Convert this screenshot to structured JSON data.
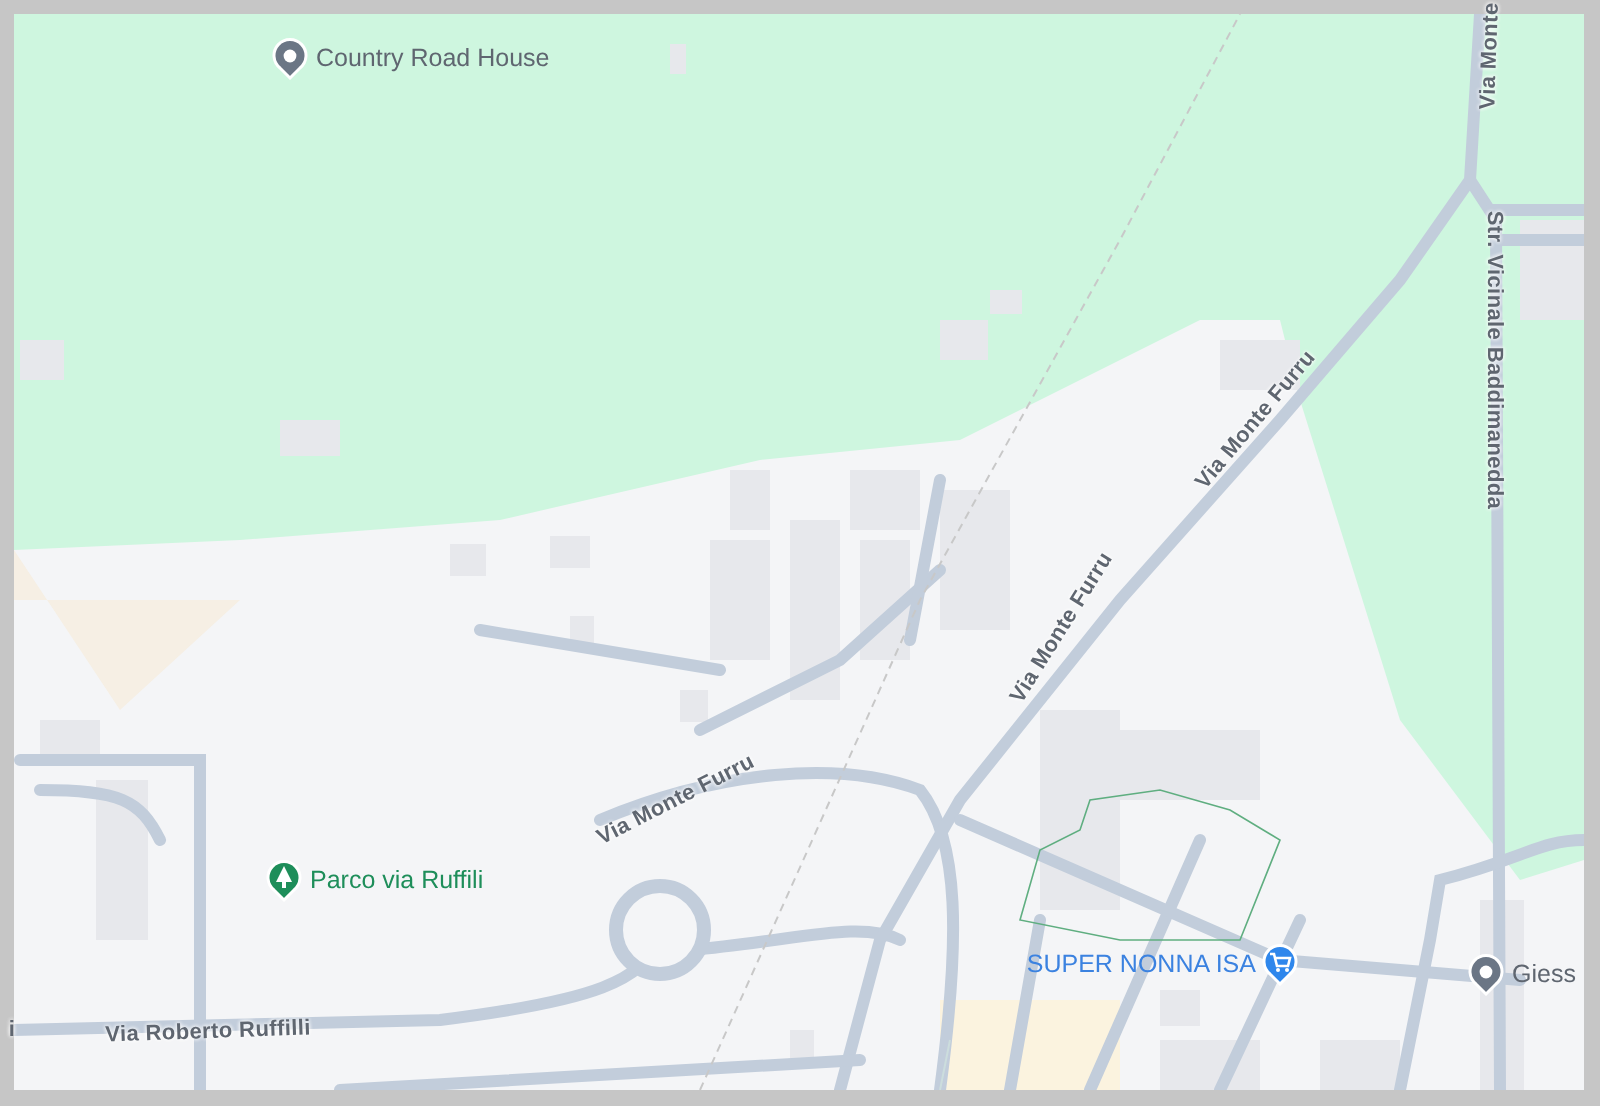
{
  "places": [
    {
      "name": "Country Road House",
      "kind": "pin"
    },
    {
      "name": "Parco via Ruffili",
      "kind": "park"
    },
    {
      "name": "SUPER NONNA ISA",
      "kind": "shop"
    },
    {
      "name": "Giess",
      "kind": "pin"
    }
  ],
  "streets": [
    {
      "name": "Via Monte"
    },
    {
      "name": "Via Monte Furru"
    },
    {
      "name": "Via Monte Furru"
    },
    {
      "name": "Str. Vicinale Baddimanedda"
    },
    {
      "name": "Via Monte Furru"
    },
    {
      "name": "i"
    },
    {
      "name": "Via Roberto Ruffilli"
    }
  ]
}
